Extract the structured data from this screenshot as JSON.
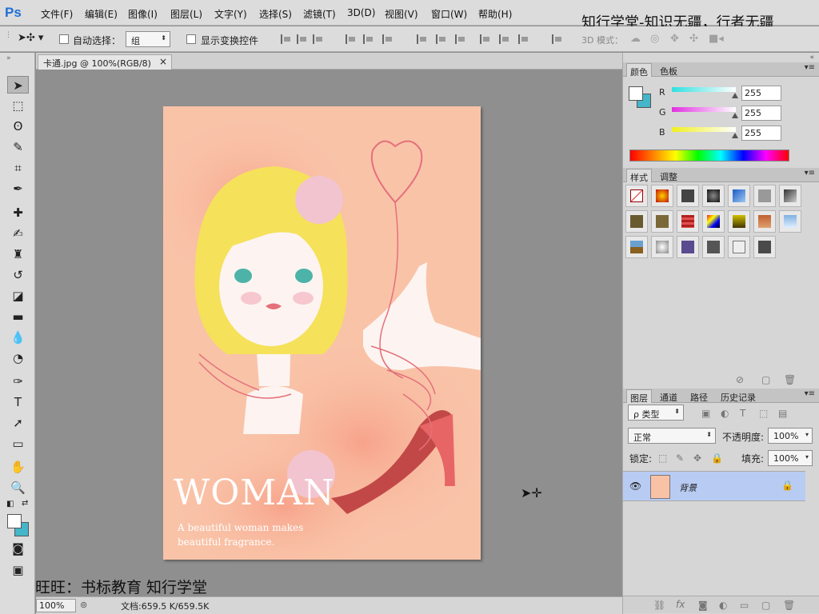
{
  "app": {
    "logo": "Ps"
  },
  "menu": [
    "文件(F)",
    "编辑(E)",
    "图像(I)",
    "图层(L)",
    "文字(Y)",
    "选择(S)",
    "滤镜(T)",
    "3D(D)",
    "视图(V)",
    "窗口(W)",
    "帮助(H)"
  ],
  "watermark_top": "知行学堂-知识无疆，行者无疆",
  "options": {
    "auto_select_label": "自动选择：",
    "auto_select_value": "组",
    "show_transform_label": "显示变换控件",
    "mode3d_label": "3D 模式："
  },
  "document": {
    "tab_title": "卡通.jpg @ 100%(RGB/8)",
    "close_glyph": "×",
    "art_title": "WOMAN",
    "art_sub_line1": "A beautiful woman makes",
    "art_sub_line2": "beautiful fragrance."
  },
  "status": {
    "zoom": "100%",
    "doc_info": "文档:659.5 K/659.5K"
  },
  "watermark_bottom": "旺旺：书标教育 知行学堂",
  "color_panel": {
    "tabs": [
      "颜色",
      "色板"
    ],
    "channels": [
      {
        "label": "R",
        "value": "255",
        "color": "#25c7d6"
      },
      {
        "label": "G",
        "value": "255",
        "color": "#d63ad6"
      },
      {
        "label": "B",
        "value": "255",
        "color": "#e8e826"
      }
    ]
  },
  "styles_panel": {
    "tabs": [
      "样式",
      "调整"
    ]
  },
  "layers_panel": {
    "tabs": [
      "图层",
      "通道",
      "路径",
      "历史记录"
    ],
    "filter_label": "ρ 类型",
    "blend_mode": "正常",
    "opacity_label": "不透明度:",
    "opacity_value": "100%",
    "lock_label": "锁定:",
    "fill_label": "填充:",
    "fill_value": "100%",
    "layer_name": "背景"
  }
}
